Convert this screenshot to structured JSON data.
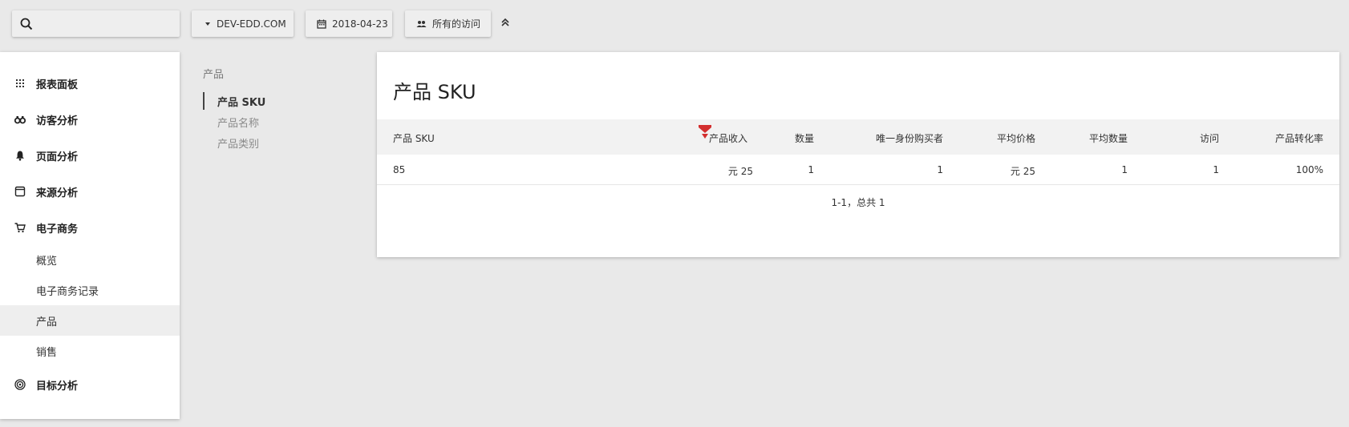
{
  "topbar": {
    "search": {
      "placeholder": "",
      "value": ""
    },
    "site": {
      "label": "DEV-EDD.COM"
    },
    "date": {
      "label": "2018-04-23"
    },
    "segment": {
      "label": "所有的访问"
    }
  },
  "menu": {
    "items": [
      {
        "label": "报表面板",
        "icon": "grid-icon"
      },
      {
        "label": "访客分析",
        "icon": "binoculars-icon"
      },
      {
        "label": "页面分析",
        "icon": "bell-icon"
      },
      {
        "label": "来源分析",
        "icon": "window-icon"
      },
      {
        "label": "电子商务",
        "icon": "cart-icon"
      }
    ],
    "sub_items": [
      {
        "label": "概览"
      },
      {
        "label": "电子商务记录"
      },
      {
        "label": "产品",
        "active": true
      },
      {
        "label": "销售"
      }
    ],
    "goals": {
      "label": "目标分析",
      "icon": "target-icon"
    }
  },
  "subnav": {
    "title": "产品",
    "items": [
      {
        "label": "产品 SKU",
        "active": true
      },
      {
        "label": "产品名称"
      },
      {
        "label": "产品类别"
      }
    ]
  },
  "report": {
    "title": "产品 SKU",
    "columns": [
      "产品 SKU",
      "产品收入",
      "数量",
      "唯一身份购买者",
      "平均价格",
      "平均数量",
      "访问",
      "产品转化率"
    ],
    "rows": [
      [
        "85",
        "元 25",
        "1",
        "1",
        "元 25",
        "1",
        "1",
        "100%"
      ]
    ],
    "pagination": "1-1，总共 1"
  },
  "colors": {
    "background": "#e9e9e9",
    "sort_indicator": "#d32f2f"
  }
}
